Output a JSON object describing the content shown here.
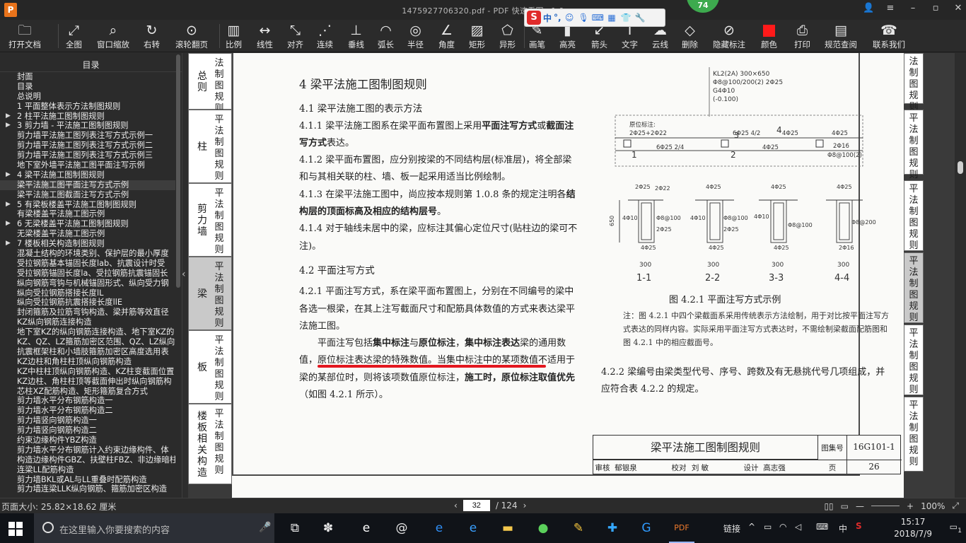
{
  "window": {
    "title": "1475927706320.pdf - PDF 快速看图 v1.9",
    "logo": "P",
    "badge": "74",
    "controls": [
      "user-icon",
      "menu-icon",
      "minimize-icon",
      "maximize-icon",
      "close-icon"
    ]
  },
  "ime": {
    "logo": "S",
    "mode": "中",
    "punct": "°,"
  },
  "toolbar": [
    {
      "id": "open",
      "label": "打开文档",
      "icon": "folder-icon"
    },
    {
      "id": "fit",
      "label": "全图",
      "icon": "fullscreen-icon"
    },
    {
      "id": "zoom",
      "label": "窗口缩放",
      "icon": "magnifier-icon"
    },
    {
      "id": "rotate",
      "label": "右转",
      "icon": "rotate-icon"
    },
    {
      "id": "scroll",
      "label": "滚轮翻页",
      "icon": "mouse-icon"
    },
    {
      "id": "scale",
      "label": "比例",
      "icon": "ruler-icon"
    },
    {
      "id": "linear",
      "label": "线性",
      "icon": "linear-measure-icon"
    },
    {
      "id": "align",
      "label": "对齐",
      "icon": "align-measure-icon"
    },
    {
      "id": "chain",
      "label": "连续",
      "icon": "chain-measure-icon"
    },
    {
      "id": "perp",
      "label": "垂线",
      "icon": "perpendicular-icon"
    },
    {
      "id": "arc",
      "label": "弧长",
      "icon": "arc-length-icon"
    },
    {
      "id": "radius",
      "label": "半径",
      "icon": "radius-icon"
    },
    {
      "id": "angle",
      "label": "角度",
      "icon": "angle-icon"
    },
    {
      "id": "rect",
      "label": "矩形",
      "icon": "rect-area-icon"
    },
    {
      "id": "poly",
      "label": "异形",
      "icon": "polygon-area-icon"
    },
    {
      "id": "pen",
      "label": "画笔",
      "icon": "pen-icon"
    },
    {
      "id": "highlight",
      "label": "高亮",
      "icon": "highlight-icon"
    },
    {
      "id": "arrow",
      "label": "箭头",
      "icon": "arrow-icon"
    },
    {
      "id": "text",
      "label": "文字",
      "icon": "text-icon"
    },
    {
      "id": "cloud",
      "label": "云线",
      "icon": "cloud-icon"
    },
    {
      "id": "delete",
      "label": "删除",
      "icon": "eraser-icon"
    },
    {
      "id": "hide",
      "label": "隐藏标注",
      "icon": "hide-icon"
    },
    {
      "id": "color",
      "label": "颜色",
      "icon": "color-swatch-icon"
    },
    {
      "id": "print",
      "label": "打印",
      "icon": "printer-icon"
    },
    {
      "id": "spec",
      "label": "规范查阅",
      "icon": "book-icon"
    },
    {
      "id": "contact",
      "label": "联系我们",
      "icon": "support-icon"
    }
  ],
  "sidebar": {
    "header": "目录",
    "items": [
      {
        "label": "封面",
        "arrow": ""
      },
      {
        "label": "目录",
        "arrow": ""
      },
      {
        "label": "总说明",
        "arrow": ""
      },
      {
        "label": "1 平面整体表示方法制图规则",
        "arrow": ""
      },
      {
        "label": "2 柱平法施工图制图规则",
        "arrow": "▶"
      },
      {
        "label": "3 剪力墙 - 平法施工图制图规则",
        "arrow": "▶"
      },
      {
        "label": "剪力墙平法施工图列表注写方式示例一",
        "arrow": ""
      },
      {
        "label": "剪力墙平法施工图列表注写方式示例二",
        "arrow": ""
      },
      {
        "label": "剪力墙平法施工图列表注写方式示例三",
        "arrow": ""
      },
      {
        "label": "地下室外墙平法施工图平面注写示例",
        "arrow": ""
      },
      {
        "label": "4 梁平法施工图制图规则",
        "arrow": "▶"
      },
      {
        "label": "梁平法施工图平面注写方式示例",
        "arrow": "",
        "active": true
      },
      {
        "label": "梁平法施工图截面注写方式示例",
        "arrow": ""
      },
      {
        "label": "5 有梁板楼盖平法施工图制图规则",
        "arrow": "▶"
      },
      {
        "label": "有梁楼盖平法施工图示例",
        "arrow": ""
      },
      {
        "label": "6 无梁楼盖平法施工图制图规则",
        "arrow": "▶"
      },
      {
        "label": "无梁楼盖平法施工图示例",
        "arrow": ""
      },
      {
        "label": "7 楼板相关构造制图规则",
        "arrow": "▶"
      },
      {
        "label": "混凝土结构的环境类别、保护层的最小厚度",
        "arrow": ""
      },
      {
        "label": "受拉钢筋基本锚固长度lab、抗震设计时受",
        "arrow": ""
      },
      {
        "label": "受拉钢筋锚固长度la、受拉钢筋抗震锚固长",
        "arrow": ""
      },
      {
        "label": "纵向钢筋弯钩与机械锚固形式、纵向受力钢",
        "arrow": ""
      },
      {
        "label": "纵向受拉钢筋搭接长度lL",
        "arrow": ""
      },
      {
        "label": "纵向受拉钢筋抗震搭接长度llE",
        "arrow": ""
      },
      {
        "label": "封闭箍筋及拉筋弯钩构造、梁并筋等效直径",
        "arrow": ""
      },
      {
        "label": "KZ纵向钢筋连接构造",
        "arrow": ""
      },
      {
        "label": "地下室KZ的纵向钢筋连接构造、地下室KZ的",
        "arrow": ""
      },
      {
        "label": "KZ、QZ、LZ箍筋加密区范围、QZ、LZ纵向钢",
        "arrow": ""
      },
      {
        "label": "抗震框架柱和小墙肢箍筋加密区高度选用表",
        "arrow": ""
      },
      {
        "label": "KZ边柱和角柱柱顶纵向钢筋构造",
        "arrow": ""
      },
      {
        "label": "KZ中柱柱顶纵向钢筋构造、KZ柱变截面位置",
        "arrow": ""
      },
      {
        "label": "KZ边柱、角柱柱顶等截面伸出时纵向钢筋构",
        "arrow": ""
      },
      {
        "label": "芯柱XZ配筋构造、矩形箍筋复合方式",
        "arrow": ""
      },
      {
        "label": "剪力墙水平分布钢筋构造一",
        "arrow": ""
      },
      {
        "label": "剪力墙水平分布钢筋构造二",
        "arrow": ""
      },
      {
        "label": "剪力墙竖向钢筋构造一",
        "arrow": ""
      },
      {
        "label": "剪力墙竖向钢筋构造二",
        "arrow": ""
      },
      {
        "label": "约束边缘构件YBZ构造",
        "arrow": ""
      },
      {
        "label": "剪力墙水平分布钢筋计入约束边缘构件、体",
        "arrow": ""
      },
      {
        "label": "构造边缘构件GBZ、扶壁柱FBZ、非边缘暗柱",
        "arrow": ""
      },
      {
        "label": "连梁LL配筋构造",
        "arrow": ""
      },
      {
        "label": "剪力墙BKL或AL与LL重叠时配筋构造",
        "arrow": ""
      },
      {
        "label": "剪力墙连梁LLK纵向钢筋、箍筋加密区构造",
        "arrow": ""
      }
    ]
  },
  "left_tabs": [
    {
      "text": "总则",
      "side": "法制图规则"
    },
    {
      "text": "柱",
      "side": "平法制图规则"
    },
    {
      "text": "剪力墙",
      "side": "平法制图规则"
    },
    {
      "text": "梁",
      "side": "平法制图规则",
      "active": true
    },
    {
      "text": "板",
      "side": "平法制图规则"
    },
    {
      "text": "楼板相关构造",
      "side": "平法制图规则"
    }
  ],
  "right_tabs": [
    {
      "text": "法制图规则"
    },
    {
      "text": "平法制图规则"
    },
    {
      "text": "平法制图规则"
    },
    {
      "text": "平法制图规则",
      "active": true
    },
    {
      "text": "平法制图规则"
    },
    {
      "text": "平法制图规则"
    }
  ],
  "doc": {
    "h1": "4 梁平法施工图制图规则",
    "h2a": "4.1 梁平法施工图的表示方法",
    "p411": [
      "4.1.1 梁平法施工图系在梁平面布置图上采用",
      "平面注写方式",
      "或",
      "截面注写方式",
      "表达。"
    ],
    "p412": "4.1.2 梁平面布置图，应分别按梁的不同结构层(标准层)，将全部梁和与其相关联的柱、墙、板一起采用适当比例绘制。",
    "p413": [
      "4.1.3 在梁平法施工图中，尚应按本规则第 1.0.8 条的规定注明各",
      "结构层的顶面标高及相应的结构层号",
      "。"
    ],
    "p414": "4.1.4 对于轴线未居中的梁，应标注其偏心定位尺寸(贴柱边的梁可不注)。",
    "h2b": "4.2 平面注写方式",
    "p421": "4.2.1 平面注写方式，系在梁平面布置图上，分别在不同编号的梁中各选一根梁，在其上注写截面尺寸和配筋具体数值的方式来表达梁平法施工图。",
    "p421b": [
      "平面注写包括",
      "集中标注",
      "与",
      "原位标注",
      "，",
      "集中标注表达",
      "梁的通用数值，原位标注表达梁的特殊数值。当集中标注中的某项数值不适用于梁的某部位时，则将该项数值原位标注，",
      "施工时，原位标注取值优先",
      "（如图 4.2.1 所示）。"
    ],
    "fig_caption": "图 4.2.1 平面注写方式示例",
    "fig_note": "注：图 4.2.1 中四个梁截面系采用传统表示方法绘制，用于对比按平面注写方式表达的同样内容。实际采用平面注写方式表达时，不需绘制梁截面配筋图和图 4.2.1 中的相应截面号。",
    "p422": "4.2.2 梁编号由梁类型代号、序号、跨数及有无悬挑代号几项组成，并应符合表 4.2.2 的规定。",
    "fig": {
      "kl_lines": [
        "KL2(2A) 300×650",
        "Φ8@100/200(2) 2Φ25",
        "G4Φ10",
        "(-0.100)"
      ],
      "orig_label": "原位标注:",
      "orig_bars": "2Φ25+2Φ22",
      "mid_top": "6Φ25 4/2",
      "mid_top2": "4Φ25",
      "right_top": "4Φ25",
      "right_a": "2Φ16",
      "right_b": "Φ8@100(2)",
      "bottom_left": "6Φ25 2/4",
      "bottom_mid": "4Φ25",
      "spans": [
        "1",
        "2",
        "3",
        "4"
      ],
      "section_labels": [
        "1-1",
        "2-2",
        "3-3",
        "4-4"
      ],
      "widths": [
        "300",
        "300",
        "300",
        "300"
      ],
      "height": "650",
      "s1": {
        "top": "2Φ25",
        "top2": "2Φ22",
        "left": "4Φ10",
        "right": "Φ8@100",
        "r2": "2Φ25",
        "bot": "4Φ25"
      },
      "s2": {
        "top": "4Φ25",
        "left": "4Φ10",
        "right": "Φ8@100",
        "r2": "2Φ25",
        "bot": "4Φ25"
      },
      "s3": {
        "top": "4Φ25",
        "left": "4Φ10",
        "right": "Φ8@100",
        "bot": "4Φ25"
      },
      "s4": {
        "top": "4Φ25",
        "right": "Φ8@200",
        "bot": "2Φ16"
      }
    },
    "titleblock": {
      "title": "梁平法施工图制图规则",
      "atlas_label": "图集号",
      "atlas": "16G101-1",
      "page_label": "页",
      "page": "26",
      "row": [
        "审核",
        "郁银泉",
        "校对",
        "刘 敏",
        "设计",
        "高志强"
      ]
    }
  },
  "status": {
    "page_size": "页面大小: 25.82×18.62 厘米",
    "current_page": "32",
    "total_pages": "/ 124",
    "zoom": "100%"
  },
  "taskbar": {
    "search_placeholder": "在这里输入你要搜索的内容",
    "link_label": "链接",
    "ime": "中",
    "time": "15:17",
    "date": "2018/7/9",
    "notifications": "1"
  },
  "colors": {
    "accent_red": "#e3171f",
    "active_tab": "#c9c9c9",
    "toolbar_bg": "#2b2b2b"
  }
}
